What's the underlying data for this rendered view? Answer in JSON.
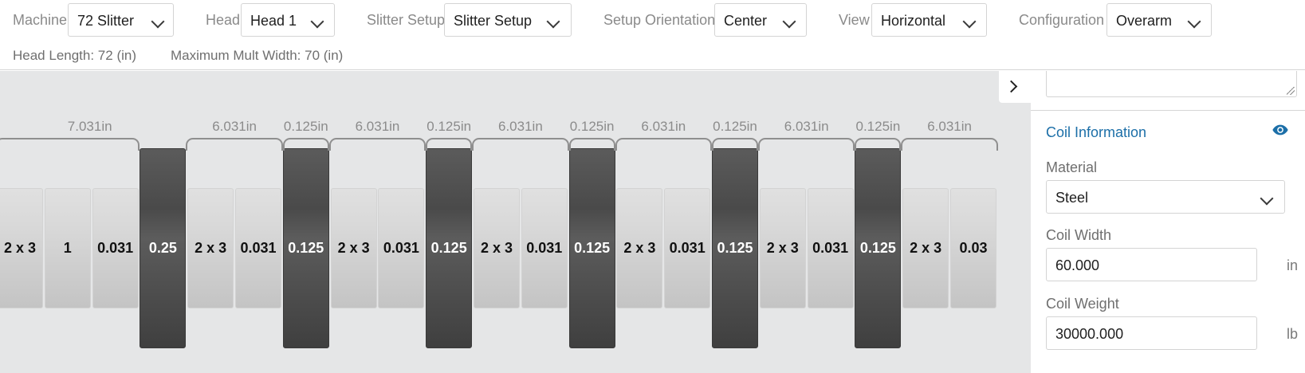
{
  "toolbar": {
    "machine": {
      "label": "Machine",
      "value": "72 Slitter"
    },
    "head": {
      "label": "Head",
      "value": "Head 1"
    },
    "slitter_setup": {
      "label": "Slitter Setup",
      "value": "Slitter Setup"
    },
    "setup_orientation": {
      "label": "Setup Orientation",
      "value": "Center"
    },
    "view": {
      "label": "View",
      "value": "Horizontal"
    },
    "configuration": {
      "label": "Configuration",
      "value": "Overarm"
    },
    "head_length": "Head Length: 72 (in)",
    "max_mult_width": "Maximum Mult Width: 70 (in)"
  },
  "dimensions": [
    "7.031in",
    "6.031in",
    "0.125in",
    "6.031in",
    "0.125in",
    "6.031in",
    "0.125in",
    "6.031in",
    "0.125in",
    "6.031in",
    "0.125in",
    "6.031in"
  ],
  "knives": [
    {
      "label": "2 x 3",
      "type": "spacer"
    },
    {
      "label": "1",
      "type": "spacer"
    },
    {
      "label": "0.031",
      "type": "spacer"
    },
    {
      "label": "0.25",
      "type": "knife"
    },
    {
      "label": "2 x 3",
      "type": "spacer"
    },
    {
      "label": "0.031",
      "type": "spacer"
    },
    {
      "label": "0.125",
      "type": "knife"
    },
    {
      "label": "2 x 3",
      "type": "spacer"
    },
    {
      "label": "0.031",
      "type": "spacer"
    },
    {
      "label": "0.125",
      "type": "knife"
    },
    {
      "label": "2 x 3",
      "type": "spacer"
    },
    {
      "label": "0.031",
      "type": "spacer"
    },
    {
      "label": "0.125",
      "type": "knife"
    },
    {
      "label": "2 x 3",
      "type": "spacer"
    },
    {
      "label": "0.031",
      "type": "spacer"
    },
    {
      "label": "0.125",
      "type": "knife"
    },
    {
      "label": "2 x 3",
      "type": "spacer"
    },
    {
      "label": "0.031",
      "type": "spacer"
    },
    {
      "label": "0.125",
      "type": "knife"
    },
    {
      "label": "2 x 3",
      "type": "spacer"
    },
    {
      "label": "0.03",
      "type": "spacer"
    }
  ],
  "panel": {
    "section_title": "Coil Information",
    "material": {
      "label": "Material",
      "value": "Steel"
    },
    "coil_width": {
      "label": "Coil Width",
      "value": "60.000",
      "unit": "in"
    },
    "coil_weight": {
      "label": "Coil Weight",
      "value": "30000.000",
      "unit": "lb"
    }
  },
  "colors": {
    "accent": "#1c6fa8",
    "knife_dark": "#4a4a4a",
    "spacer": "#d9d9d9",
    "canvas_bg": "#e5e6e7"
  },
  "icons": {
    "collapse": "chevron-right-icon",
    "visibility": "eye-icon"
  }
}
